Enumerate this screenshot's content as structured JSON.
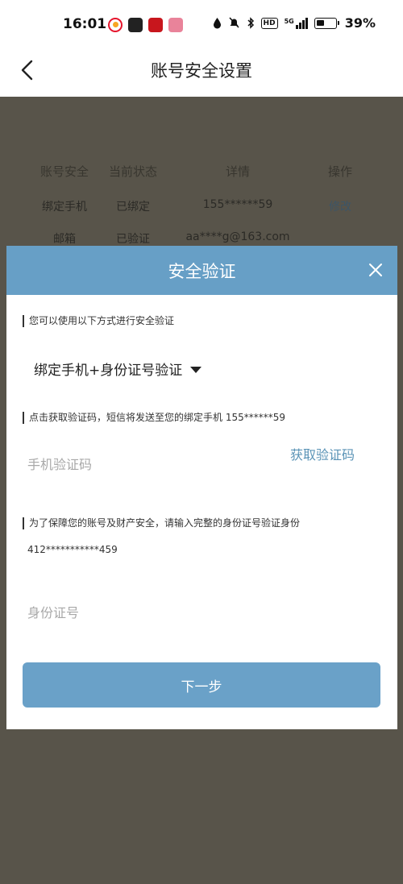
{
  "status_bar": {
    "time": "16:01",
    "app_icons": [
      "weibo-icon",
      "news-app-icon",
      "study-app-icon",
      "pink-app-icon"
    ],
    "indicators": [
      "water-drop-icon",
      "bell-muted-icon",
      "bluetooth-icon",
      "hd-icon",
      "5g-signal-icon",
      "battery-icon"
    ],
    "hd_label": "HD",
    "network_label": "5G",
    "battery_percent": "39%"
  },
  "nav": {
    "title": "账号安全设置",
    "back_icon": "chevron-left-icon"
  },
  "security_table": {
    "headers": [
      "账号安全",
      "当前状态",
      "详情",
      "操作"
    ],
    "rows": [
      [
        "绑定手机",
        "已绑定",
        "155******59",
        "修改"
      ],
      [
        "邮箱",
        "已验证",
        "aa****g@163.com",
        ""
      ]
    ]
  },
  "dialog": {
    "title": "安全验证",
    "close_icon": "close-icon",
    "method_hint": "您可以使用以下方式进行安全验证",
    "method_selected": "绑定手机+身份证号验证",
    "sms_hint": "点击获取验证码，短信将发送至您的绑定手机 155******59",
    "code_placeholder": "手机验证码",
    "get_code_label": "获取验证码",
    "id_hint": "为了保障您的账号及财产安全，请输入完整的身份证号验证身份",
    "id_masked": "412***********459",
    "id_placeholder": "身份证号",
    "next_label": "下一步"
  },
  "colors": {
    "accent": "#679fc6",
    "overlay": "#58544a",
    "link": "#5a93b6"
  }
}
